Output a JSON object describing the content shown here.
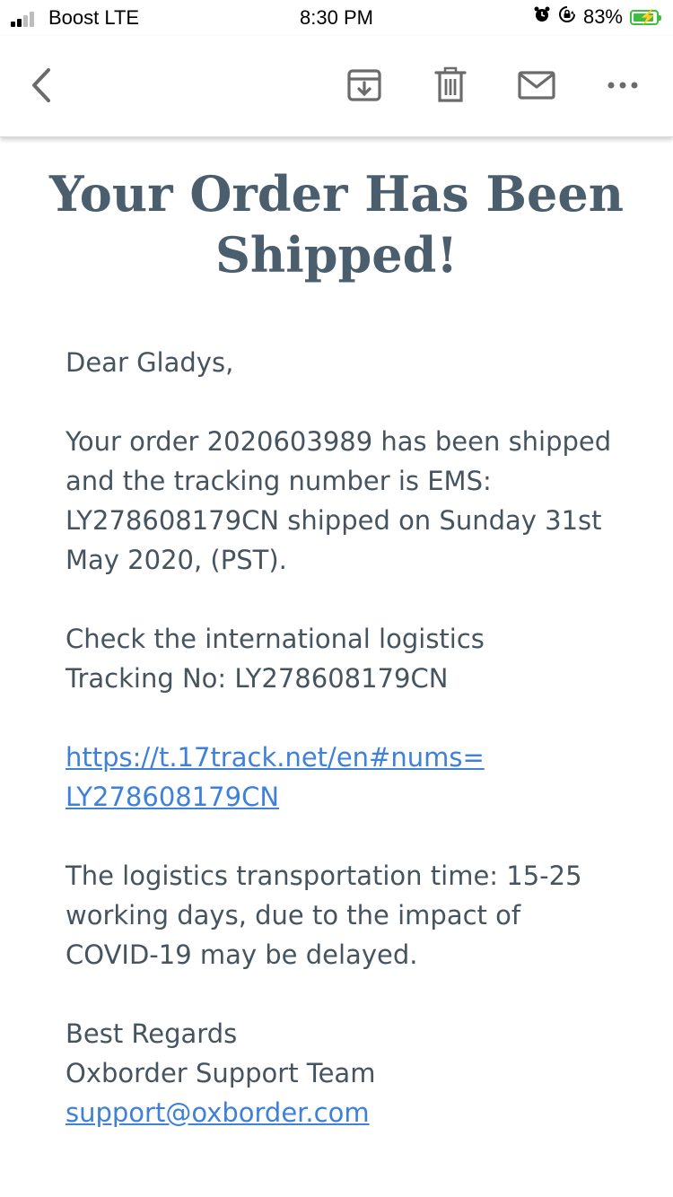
{
  "status_bar": {
    "carrier": "Boost LTE",
    "time": "8:30 PM",
    "battery_percent": "83%",
    "signal_bars_filled": 2,
    "colors": {
      "battery": "#3ebd3e"
    },
    "icons": [
      "alarm-icon",
      "orientation-lock-icon",
      "battery-icon"
    ]
  },
  "toolbar": {
    "icons": [
      "back-chevron-icon",
      "archive-icon",
      "trash-icon",
      "mail-icon",
      "more-dots-icon"
    ]
  },
  "email": {
    "headline": "Your Order Has Been Shipped!",
    "greeting": "Dear Gladys,",
    "paragraph1": "Your order 2020603989 has been shipped and the tracking number is EMS: LY278608179CN shipped on Sunday 31st May 2020, (PST).",
    "paragraph2_line1": "Check the international logistics",
    "paragraph2_line2": "Tracking No: LY278608179CN",
    "tracking_link_line1": "https://t.17track.net/en#nums=",
    "tracking_link_line2": "LY278608179CN",
    "paragraph3": "The logistics transportation time: 15-25 working days, due to the impact of COVID-19 may be delayed.",
    "signoff": "Best Regards",
    "team": "Oxborder Support Team",
    "support_email": "support@oxborder.com"
  },
  "colors": {
    "headline": "#4a5e6d",
    "body_text": "#46545f",
    "link": "#3f80d9",
    "icons": "#6b6b6b"
  }
}
